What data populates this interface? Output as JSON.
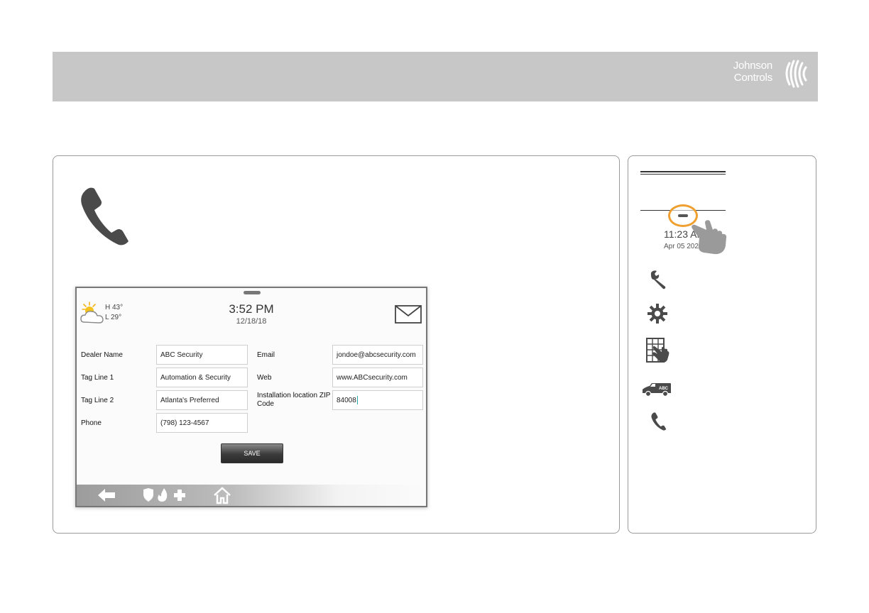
{
  "brand": {
    "name_line1": "Johnson",
    "name_line2": "Controls"
  },
  "device": {
    "weather": {
      "high": "H 43°",
      "low": "L 29°",
      "icon": "partly-cloudy-icon"
    },
    "clock": {
      "time": "3:52 PM",
      "date": "12/18/18"
    },
    "form": {
      "dealer_name_label": "Dealer Name",
      "dealer_name_value": "ABC Security",
      "tag_line_1_label": "Tag Line 1",
      "tag_line_1_value": "Automation & Security",
      "tag_line_2_label": "Tag Line 2",
      "tag_line_2_value": "Atlanta's Preferred",
      "phone_label": "Phone",
      "phone_value": "(798) 123-4567",
      "email_label": "Email",
      "email_value": "jondoe@abcsecurity.com",
      "web_label": "Web",
      "web_value": "www.ABCsecurity.com",
      "zip_label": "Installation location ZIP Code",
      "zip_value": "84008",
      "save_label": "SAVE"
    },
    "bottom_bar": [
      "back-arrow-icon",
      "emergency-panic-icons",
      "home-icon"
    ]
  },
  "side_menu": {
    "time": "11:23 AM",
    "date": "Apr 05 2021",
    "icons": [
      "wrench-icon",
      "gear-icon",
      "touch-grid-icon",
      "dealer-van-icon",
      "phone-icon"
    ],
    "van_badge": "ABC"
  },
  "colors": {
    "banner": "#c7c7c7",
    "highlight_ring": "#f0a030"
  }
}
